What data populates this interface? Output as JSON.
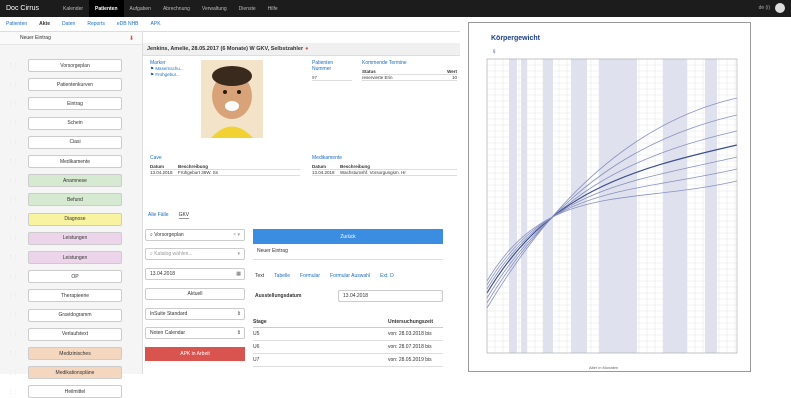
{
  "topbar": {
    "brand": "Doc Cirrus",
    "menu": [
      "Kalender",
      "Patienten",
      "Aufgaben",
      "Abrechnung",
      "Verwaltung",
      "Dienste",
      "Hilfe"
    ],
    "active_index": 1,
    "right_text": "de (i)"
  },
  "subnav": {
    "items": [
      "Patienten",
      "Akte",
      "Daten",
      "Reports",
      "eDB NHB",
      "APK"
    ],
    "active_index": 1
  },
  "sidebar": {
    "new_entry": "Neuer Eintrag",
    "new_entry_icon": "arrow-down-icon",
    "items": [
      {
        "label": "Vorsorgeplan",
        "color": "#ffffff"
      },
      {
        "label": "Patientenkurven",
        "color": "#ffffff"
      },
      {
        "label": "Eintrag",
        "color": "#ffffff"
      },
      {
        "label": "Schein",
        "color": "#ffffff"
      },
      {
        "label": "Ciasi",
        "color": "#ffffff"
      },
      {
        "label": "Medikamente",
        "color": "#ffffff"
      },
      {
        "label": "Anamnese",
        "color": "#d5ead0"
      },
      {
        "label": "Befund",
        "color": "#d5ead0"
      },
      {
        "label": "Diagnose",
        "color": "#f8f3a0"
      },
      {
        "label": "Leistungen",
        "color": "#ecd5ea"
      },
      {
        "label": "Leistungen",
        "color": "#ecd5ea"
      },
      {
        "label": "OP",
        "color": "#ffffff"
      },
      {
        "label": "Therapieerie",
        "color": "#ffffff"
      },
      {
        "label": "Gravidogramm",
        "color": "#ffffff"
      },
      {
        "label": "Verlaufstext",
        "color": "#ffffff"
      },
      {
        "label": "Medizinisches",
        "color": "#f5d7bf"
      },
      {
        "label": "Medikationspläne",
        "color": "#f5d7bf"
      },
      {
        "label": "Heilmittel",
        "color": "#ffffff"
      }
    ]
  },
  "patient": {
    "header": "Jenkins, Amelie, 28.05.2017 (6 Monate) W GKV, Selbstzahler",
    "marker_label": "Marker",
    "marker_items": [
      "Masernschu...",
      "Frühgebur..."
    ],
    "patient_number_label": "Patienten Nummer",
    "patient_number": "97",
    "upcoming_label": "Kommende Termine",
    "upcoming_cols": [
      "Status",
      "Wert"
    ],
    "upcoming_row": [
      "reservierte Erin",
      "10"
    ],
    "cave_label": "Cave",
    "cave_cols": [
      "Datum",
      "Beschreibung"
    ],
    "cave_row": [
      "13.04.2018",
      "Frühgeburt 36W. Ss"
    ],
    "meds_label": "Medikamente",
    "meds_cols": [
      "Datum",
      "Beschreibung"
    ],
    "meds_row": [
      "13.04.2018",
      "Wachstumshf. Vorsorgungsm. Hr"
    ]
  },
  "form": {
    "tabs": [
      "Alle Fälle",
      "GKV"
    ],
    "active_tab": 1,
    "vorsorge_value": "Vorsorgeplan",
    "katalog_placeholder": "Katalog wählen...",
    "date_value": "13.04.2018",
    "aktuell_label": "Aktuell",
    "schein_value": "InSuite Standard",
    "kein_value": "Noten Calendar",
    "red_button": "APK in Arbeit",
    "back_button": "Zurück",
    "new_entry": "Neuer Eintrag",
    "subtabs": [
      "Text",
      "Tabelle",
      "Formular",
      "Formular Auswahl",
      "Ext. D"
    ],
    "active_subtab": 0,
    "issue_label": "Ausstellungsdatum",
    "issue_value": "13.04.2018",
    "stage_col": "Stage",
    "date_col": "Untersuchungszeit",
    "rows": [
      {
        "stage": "U5",
        "date": "von: 28.03.2018 bis"
      },
      {
        "stage": "U6",
        "date": "von: 28.07.2018 bis"
      },
      {
        "stage": "U7",
        "date": "von: 28.05.2019 bis"
      }
    ]
  },
  "growth_chart": {
    "title": "Körpergewicht",
    "sex_icon": "female-icon",
    "x_axis_label": "Alter in Monaten"
  }
}
